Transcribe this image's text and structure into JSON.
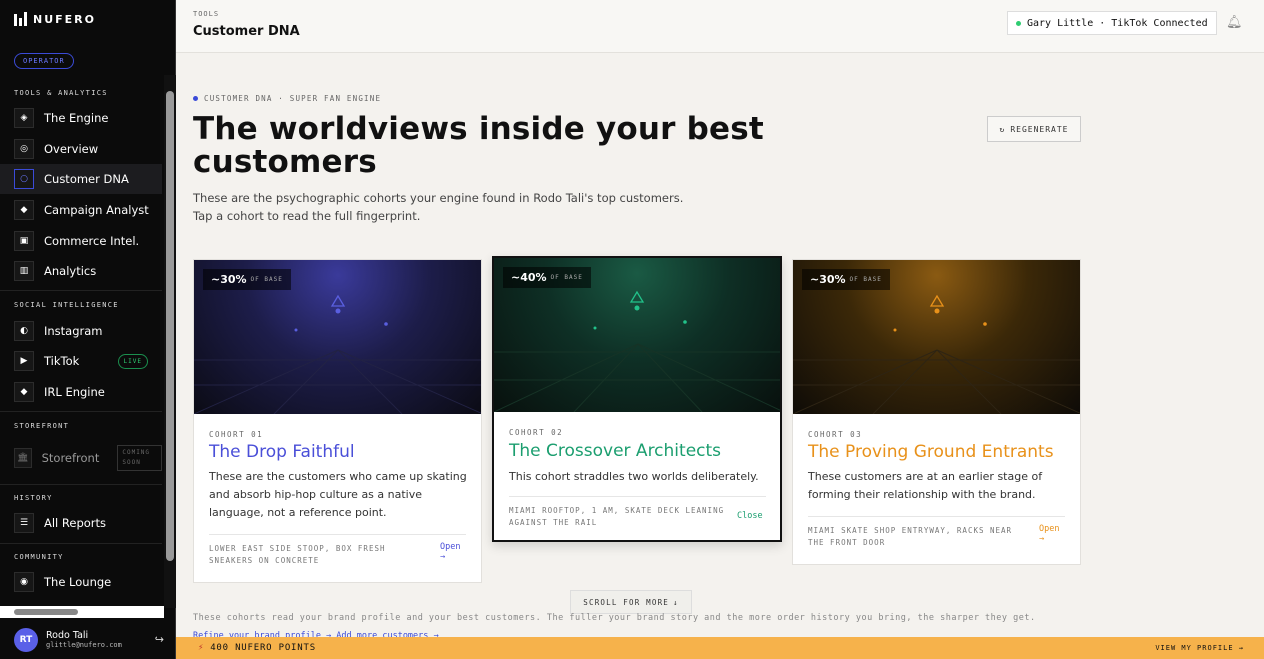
{
  "brand": {
    "name": "NUFERO",
    "role_badge": "OPERATOR"
  },
  "sidebar": {
    "sections": [
      {
        "label": "TOOLS & ANALYTICS",
        "items": [
          {
            "label": "The Engine",
            "icon": "◈"
          },
          {
            "label": "Overview",
            "icon": "◎"
          },
          {
            "label": "Customer DNA",
            "icon": "○",
            "active": true
          },
          {
            "label": "Campaign Analyst",
            "icon": "◆"
          },
          {
            "label": "Commerce Intel.",
            "icon": "▣"
          },
          {
            "label": "Analytics",
            "icon": "▥"
          }
        ]
      },
      {
        "label": "SOCIAL INTELLIGENCE",
        "items": [
          {
            "label": "Instagram",
            "icon": "◐"
          },
          {
            "label": "TikTok",
            "icon": "▶",
            "badge": "LIVE"
          },
          {
            "label": "IRL Engine",
            "icon": "◆"
          }
        ]
      },
      {
        "label": "STOREFRONT",
        "items": [
          {
            "label": "Storefront",
            "icon": "🏛",
            "badge": "COMING SOON"
          }
        ]
      },
      {
        "label": "HISTORY",
        "items": [
          {
            "label": "All Reports",
            "icon": "☰"
          }
        ]
      },
      {
        "label": "COMMUNITY",
        "items": [
          {
            "label": "The Lounge",
            "icon": "◉"
          }
        ]
      }
    ],
    "user": {
      "initials": "RT",
      "name": "Rodo Tali",
      "email": "glittle@nufero.com"
    }
  },
  "topbar": {
    "section": "TOOLS",
    "title": "Customer DNA",
    "connection": "Gary Little · TikTok Connected"
  },
  "main": {
    "eyebrow": "CUSTOMER DNA · SUPER FAN ENGINE",
    "heading": "The worldviews inside your best customers",
    "subtitle": "These are the psychographic cohorts your engine found in Rodo Tali's top customers. Tap a cohort to read the full fingerprint.",
    "regenerate": "REGENERATE",
    "cohorts": [
      {
        "pct": "~30%",
        "pct_label": "OF BASE",
        "tag": "COHORT 01",
        "title": "The Drop Faithful",
        "desc": "These are the customers who came up skating and absorb hip-hop culture as a native language, not a reference point.",
        "scene": "LOWER EAST SIDE STOOP, BOX FRESH SNEAKERS ON CONCRETE",
        "action": "Open →",
        "color": "#4a4fd8"
      },
      {
        "pct": "~40%",
        "pct_label": "OF BASE",
        "tag": "COHORT 02",
        "title": "The Crossover Architects",
        "desc": "This cohort straddles two worlds deliberately.",
        "scene": "MIAMI ROOFTOP, 1 AM, SKATE DECK LEANING AGAINST THE RAIL",
        "action": "Close",
        "color": "#1b9e6f"
      },
      {
        "pct": "~30%",
        "pct_label": "OF BASE",
        "tag": "COHORT 03",
        "title": "The Proving Ground Entrants",
        "desc": "These customers are at an earlier stage of forming their relationship with the brand.",
        "scene": "MIAMI SKATE SHOP ENTRYWAY, RACKS NEAR THE FRONT DOOR",
        "action": "Open →",
        "color": "#e8911a"
      }
    ],
    "scroll_more": "SCROLL FOR MORE",
    "note": "These cohorts read your brand profile and your best customers. The fuller your brand story and the more order history you bring, the sharper they get.",
    "links": "Refine your brand profile →  Add more customers →",
    "points": "400 NUFERO POINTS",
    "view_profile": "VIEW MY PROFILE →"
  }
}
